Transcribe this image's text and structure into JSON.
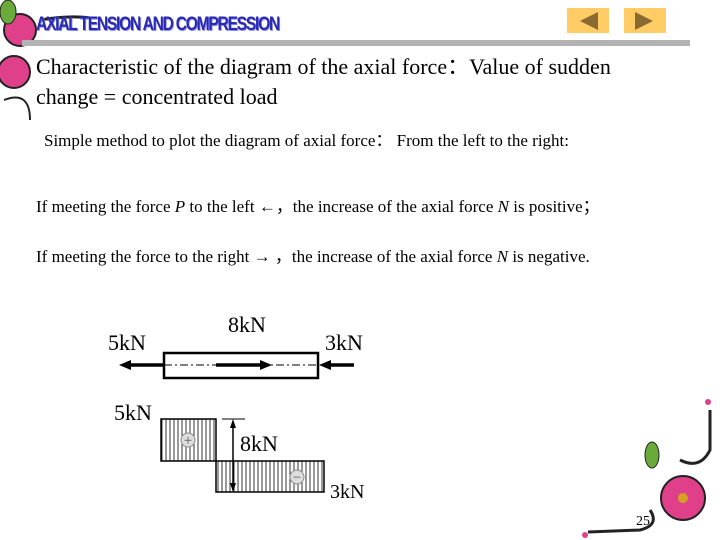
{
  "header": {
    "title": "AXIAL TENSION AND COMPRESSION",
    "prev_icon": "triangle-left-icon",
    "next_icon": "triangle-right-icon",
    "nav_color": "#ffcc66",
    "title_color": "#2a2ab0"
  },
  "content": {
    "line1": "Characteristic of the diagram of the axial force：Value of sudden change = concentrated load",
    "line2": "Simple method to plot the diagram of axial force： From the left to the right:",
    "line3_a": "If meeting the force ",
    "line3_p": "P",
    "line3_b": " to the left ",
    "line3_arrow": "←",
    "line3_c": "，the increase of the axial force ",
    "line3_n": "N",
    "line3_d": "  is positive；",
    "line4_a": "If meeting the force to the right ",
    "line4_arrow": "→",
    "line4_b": " ，the increase of the axial force ",
    "line4_n": "N",
    "line4_c": "  is negative."
  },
  "figure": {
    "bar_labels": {
      "left": "5kN",
      "middle": "8kN",
      "right": "3kN"
    },
    "diagram_labels": {
      "top": "5kN",
      "jump": "8kN",
      "bottom": "3kN"
    },
    "positive_sign": "+",
    "negative_sign": "−"
  },
  "page_number": "25"
}
